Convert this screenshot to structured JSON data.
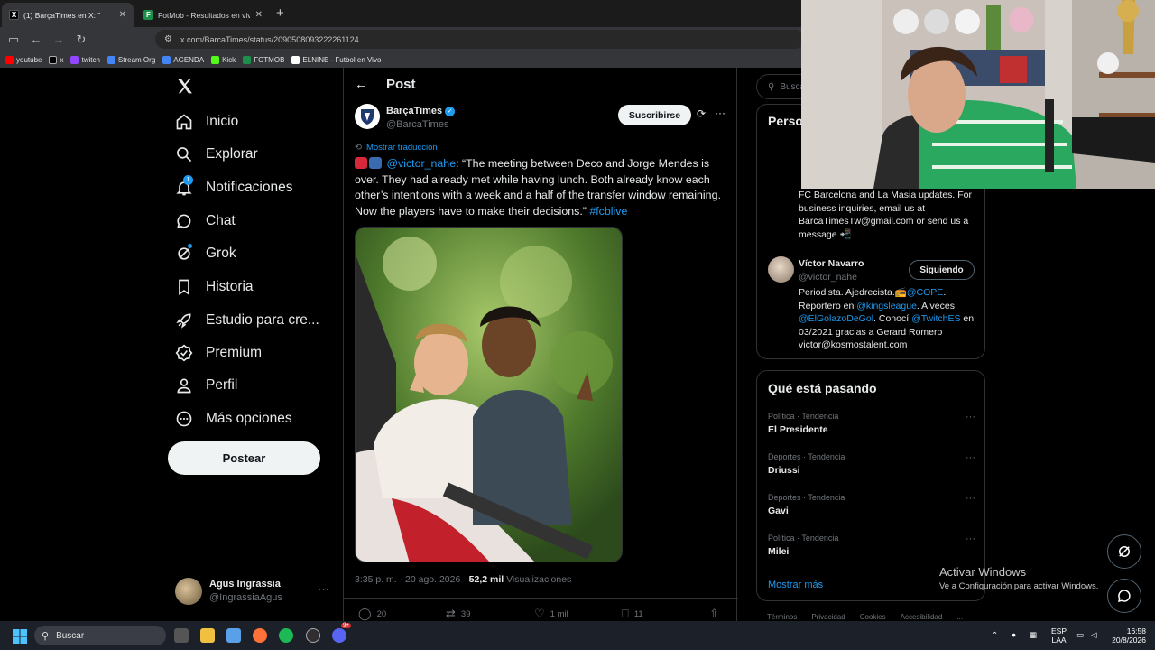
{
  "browser": {
    "tabs": [
      {
        "title": "(1) BarçaTimes en X: \"",
        "close": "✕"
      },
      {
        "title": "FotMob - Resultados en vivo de",
        "close": "✕"
      }
    ],
    "new_tab": "+",
    "url": "x.com/BarcaTimes/status/2090508093222261124",
    "bookmarks": [
      "youtube",
      "x",
      "twitch",
      "Stream Org",
      "AGENDA",
      "Kick",
      "FOTMOB",
      "ELNINE - Futbol en Vivo"
    ]
  },
  "nav": {
    "items": [
      {
        "label": "Inicio",
        "icon": "home-icon"
      },
      {
        "label": "Explorar",
        "icon": "search-icon"
      },
      {
        "label": "Notificaciones",
        "icon": "bell-icon",
        "badge": "1"
      },
      {
        "label": "Chat",
        "icon": "chat-bubble-icon"
      },
      {
        "label": "Grok",
        "icon": "grok-icon"
      },
      {
        "label": "Historia",
        "icon": "bookmark-icon"
      },
      {
        "label": "Estudio para cre...",
        "icon": "rocket-icon"
      },
      {
        "label": "Premium",
        "icon": "verified-badge-icon"
      },
      {
        "label": "Perfil",
        "icon": "person-icon"
      },
      {
        "label": "Más opciones",
        "icon": "more-circle-icon"
      }
    ],
    "post_button": "Postear",
    "account": {
      "name": "Agus Ingrassia",
      "handle": "@IngrassiaAgus"
    }
  },
  "post": {
    "header": "Post",
    "author_name": "BarçaTimes",
    "author_handle": "@BarcaTimes",
    "subscribe": "Suscribirse",
    "translate": "Mostrar traducción",
    "mention": "@victor_nahe",
    "text": ": “The meeting between Deco and Jorge Mendes is over. They had already met while having lunch. Both already know each other’s intentions with a week and a half of the transfer window remaining. Now the players have to make their decisions.” ",
    "hashtag": "#fcblive",
    "time": "3:35 p. m. · 20 ago. 2026 · ",
    "views_count": "52,2 mil",
    "views_label": " Visualizaciones",
    "replies": "20",
    "reposts": "39",
    "likes": "1 mil",
    "bookmarks": "11"
  },
  "right": {
    "search_placeholder": "Busca",
    "people_title": "Perso",
    "barca_bio": "FC Barcelona and La Masia updates. For business inquiries, email us at BarcaTimesTw@gmail.com or send us a message 📲",
    "victor": {
      "name": "Víctor Navarro",
      "handle": "@victor_nahe",
      "follow": "Siguiendo",
      "bio_1": "Periodista. Ajedrecista.📻",
      "cope": "@COPE",
      "bio_2": ". Reportero en ",
      "kings": "@kingsleague",
      "bio_3": ". A veces ",
      "golazo": "@ElGolazoDeGol",
      "bio_4": ". Conocí ",
      "twitch": "@TwitchES",
      "bio_5": " en 03/2021 gracias a Gerard Romero victor@kosmostalent.com"
    },
    "trending_title": "Qué está pasando",
    "trends": [
      {
        "meta": "Política · Tendencia",
        "name": "El Presidente"
      },
      {
        "meta": "Deportes · Tendencia",
        "name": "Driussi"
      },
      {
        "meta": "Deportes · Tendencia",
        "name": "Gavi"
      },
      {
        "meta": "Política · Tendencia",
        "name": "Milei"
      }
    ],
    "show_more": "Mostrar más",
    "footer": [
      "Términos",
      "Privacidad",
      "Cookies",
      "Accesibilidad",
      "..."
    ]
  },
  "watermark": {
    "title": "Activar Windows",
    "subtitle": "Ve a Configuración para activar Windows."
  },
  "taskbar": {
    "search": "Buscar",
    "lang_1": "ESP",
    "lang_2": "LAA",
    "time": "16:58",
    "date": "20/8/2026",
    "discord_badge": "9+"
  },
  "colors": {
    "accent": "#1d9bf0",
    "background": "#000000",
    "border": "#2f3336",
    "muted": "#71767b"
  }
}
